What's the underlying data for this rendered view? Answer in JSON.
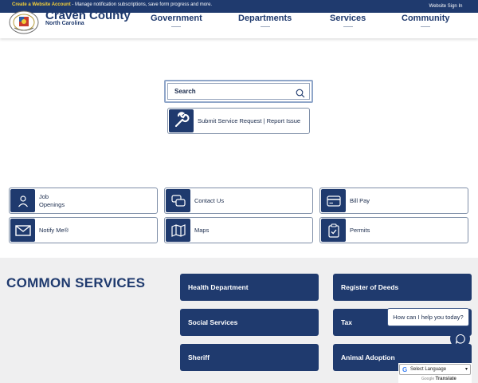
{
  "topbar": {
    "account_link": "Create a Website Account",
    "account_message": " - Manage notification subscriptions, save form progress and more.",
    "sign_in": "Website Sign In"
  },
  "brand": {
    "name": "Craven County",
    "subtitle": "North Carolina"
  },
  "nav": [
    {
      "label": "Government"
    },
    {
      "label": "Departments"
    },
    {
      "label": "Services"
    },
    {
      "label": "Community"
    }
  ],
  "search": {
    "placeholder": "Search",
    "icon": "search-icon"
  },
  "service_request": {
    "label": "Submit Service Request | Report Issue",
    "icon": "wrench-icon"
  },
  "quick_links": [
    {
      "label": "Job Openings",
      "icon": "person-icon"
    },
    {
      "label": "Contact Us",
      "icon": "chat-bubbles-icon"
    },
    {
      "label": "Bill Pay",
      "icon": "credit-card-icon"
    },
    {
      "label": "Notify Me®",
      "icon": "envelope-icon"
    },
    {
      "label": "Maps",
      "icon": "map-icon"
    },
    {
      "label": "Permits",
      "icon": "clipboard-check-icon"
    }
  ],
  "common_services": {
    "title": "COMMON SERVICES",
    "items": [
      {
        "label": "Health Department"
      },
      {
        "label": "Register of Deeds"
      },
      {
        "label": "Social Services"
      },
      {
        "label": "Tax"
      },
      {
        "label": "Sheriff"
      },
      {
        "label": "Animal Adoption"
      }
    ]
  },
  "chat": {
    "prompt": "How can I help you today?",
    "icon": "chat-icon"
  },
  "translate": {
    "select_label": "Select Language",
    "powered_by": "Google",
    "powered_word": "Translate"
  },
  "colors": {
    "primary": "#1f3a6e",
    "accent": "#f2cf3a",
    "section_bg": "#efeff0"
  }
}
